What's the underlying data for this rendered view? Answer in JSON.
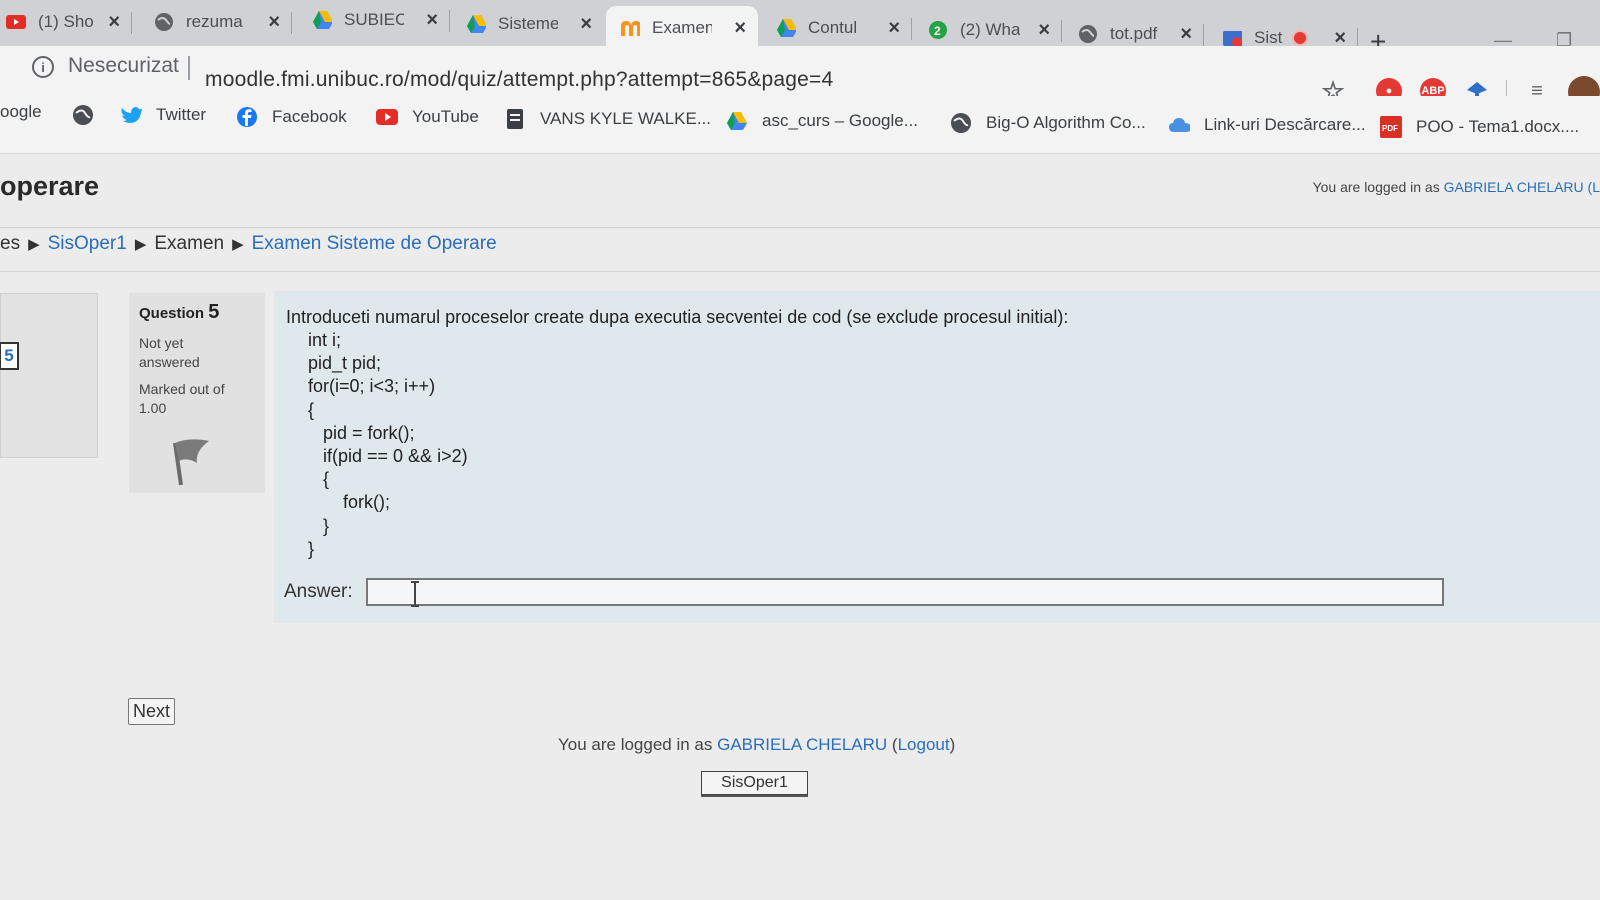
{
  "browser": {
    "tabs": [
      {
        "label": "(1) Sho",
        "icon": "youtube-icon"
      },
      {
        "label": "rezuma",
        "icon": "globe-icon"
      },
      {
        "label": "SUBIEC",
        "icon": "google-drive-icon"
      },
      {
        "label": "Sisteme",
        "icon": "google-drive-icon"
      },
      {
        "label": "Examen",
        "icon": "moodle-icon",
        "active": true
      },
      {
        "label": "Contul",
        "icon": "google-drive-icon"
      },
      {
        "label": "(2) Wha",
        "icon": "whatsapp-icon"
      },
      {
        "label": "tot.pdf",
        "icon": "globe-icon"
      },
      {
        "label": "Sist",
        "icon": "mail-icon"
      }
    ],
    "new_tab": "+",
    "close_glyph": "×",
    "address": {
      "security_label": "Nesecurizat",
      "url": "moodle.fmi.unibuc.ro/mod/quiz/attempt.php?attempt=865&page=4"
    },
    "extensions": [
      "bookmark-star-icon",
      "opera-vpn-icon",
      "adblock-plus-icon",
      "extension-icon",
      "reading-list-icon",
      "profile-avatar"
    ],
    "adblock_label": "ABP",
    "bookmarks": [
      {
        "label": "oogle",
        "icon": ""
      },
      {
        "label": "",
        "icon": "globe-icon"
      },
      {
        "label": "Twitter",
        "icon": "twitter-icon"
      },
      {
        "label": "Facebook",
        "icon": "facebook-icon"
      },
      {
        "label": "YouTube",
        "icon": "youtube-icon"
      },
      {
        "label": "VANS KYLE WALKE...",
        "icon": "sheet-icon"
      },
      {
        "label": "asc_curs – Google...",
        "icon": "google-drive-icon"
      },
      {
        "label": "Big-O Algorithm Co...",
        "icon": "globe-icon"
      },
      {
        "label": "Link-uri Descărcare...",
        "icon": "cloud-icon"
      },
      {
        "label": "POO - Tema1.docx....",
        "icon": "pdf-icon"
      }
    ]
  },
  "site": {
    "title": "operare",
    "login_top": {
      "prefix": "You are logged in as",
      "user": "GABRIELA CHELARU (L"
    },
    "breadcrumb": [
      {
        "label": "es",
        "link": false
      },
      {
        "label": "SisOper1",
        "link": true
      },
      {
        "label": "Examen",
        "link": false
      },
      {
        "label": "Examen Sisteme de Operare",
        "link": true
      }
    ],
    "breadcrumb_separator": "▶"
  },
  "quiz": {
    "nav_button": "5",
    "question_label": "Question",
    "question_number": "5",
    "state": "Not yet answered",
    "grade": "Marked out of 1.00",
    "question_text": "Introduceti numarul proceselor create dupa executia secventei de cod (se exclude procesul initial):",
    "code_lines": [
      "int i;",
      "pid_t pid;",
      "for(i=0; i<3; i++)",
      "{",
      "   pid = fork();",
      "   if(pid == 0 && i>2)",
      "   {",
      "       fork();",
      "   }",
      "}"
    ],
    "answer_label": "Answer:",
    "answer_value": "",
    "next_button": "Next"
  },
  "footer": {
    "login_prefix": "You are logged in as",
    "user": "GABRIELA CHELARU",
    "logout": "Logout",
    "home_button": "SisOper1"
  },
  "colors": {
    "link": "#2a6ebb",
    "question_bg": "#dfe8ec",
    "tab_bg": "#cfd1d4"
  }
}
